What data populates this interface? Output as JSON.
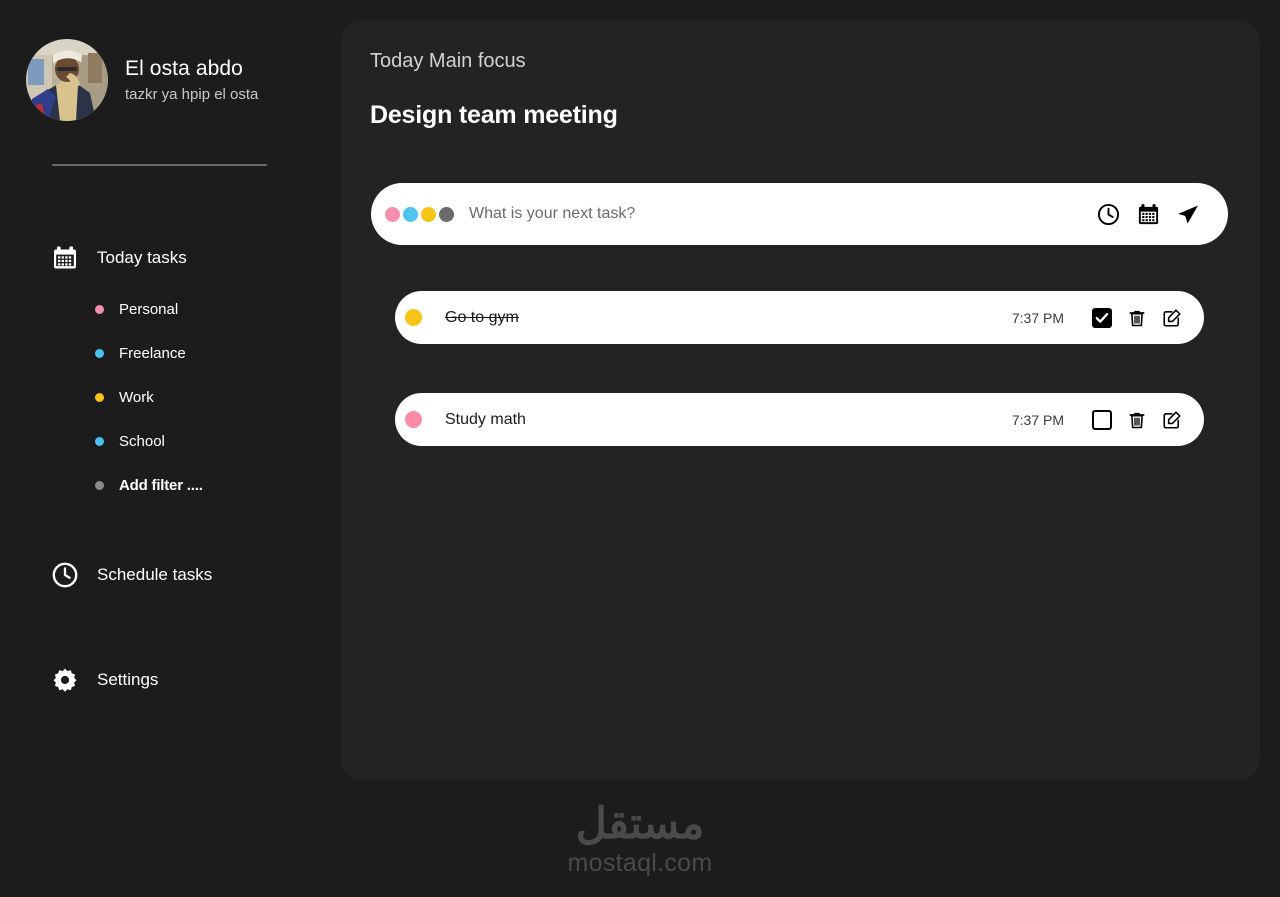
{
  "theme": {
    "page_bg": "#1c1c1c",
    "panel_bg": "#232323",
    "card_bg": "#ffffff",
    "text_primary": "#ffffff",
    "text_muted": "#c8c8c8"
  },
  "sidebar": {
    "profile": {
      "name": "El osta abdo",
      "subtitle": "tazkr ya hpip el osta",
      "avatar_icon": "user-photo-avatar"
    },
    "nav": [
      {
        "id": "today-tasks",
        "label": "Today tasks",
        "icon": "calendar-icon",
        "filters": [
          {
            "label": "Personal",
            "color": "#f490ae",
            "icon": "dot-icon"
          },
          {
            "label": "Freelance",
            "color": "#4ec3f0",
            "icon": "dot-icon"
          },
          {
            "label": "Work",
            "color": "#f5c518",
            "icon": "dot-icon"
          },
          {
            "label": "School",
            "color": "#4ec3f0",
            "icon": "dot-icon"
          },
          {
            "label": "Add filter ....",
            "color": "#8a8a8a",
            "icon": "dot-icon"
          }
        ]
      },
      {
        "id": "schedule-tasks",
        "label": "Schedule tasks",
        "icon": "clock-icon"
      },
      {
        "id": "settings",
        "label": "Settings",
        "icon": "gear-icon"
      }
    ]
  },
  "main": {
    "focus_label": "Today Main focus",
    "focus_title": "Design team meeting",
    "composer": {
      "placeholder": "What is your next task?",
      "value": "",
      "color_dots": [
        {
          "name": "personal",
          "color": "#f490ae"
        },
        {
          "name": "freelance",
          "color": "#4ec3f0"
        },
        {
          "name": "work",
          "color": "#f5c518"
        },
        {
          "name": "other",
          "color": "#6b6b6b"
        }
      ],
      "actions": [
        {
          "name": "clock-icon",
          "label": "Set time"
        },
        {
          "name": "calendar-icon",
          "label": "Set date"
        },
        {
          "name": "send-icon",
          "label": "Add task"
        }
      ]
    },
    "tasks": [
      {
        "title": "Go to gym",
        "time": "7:37 PM",
        "color": "#f5c518",
        "completed": true,
        "actions": [
          "checkbox",
          "trash-icon",
          "edit-icon"
        ]
      },
      {
        "title": "Study math",
        "time": "7:37 PM",
        "color": "#fb8ca5",
        "completed": false,
        "actions": [
          "checkbox",
          "trash-icon",
          "edit-icon"
        ]
      }
    ]
  },
  "watermark": {
    "arabic": "مستقل",
    "latin": "mostaql.com"
  }
}
